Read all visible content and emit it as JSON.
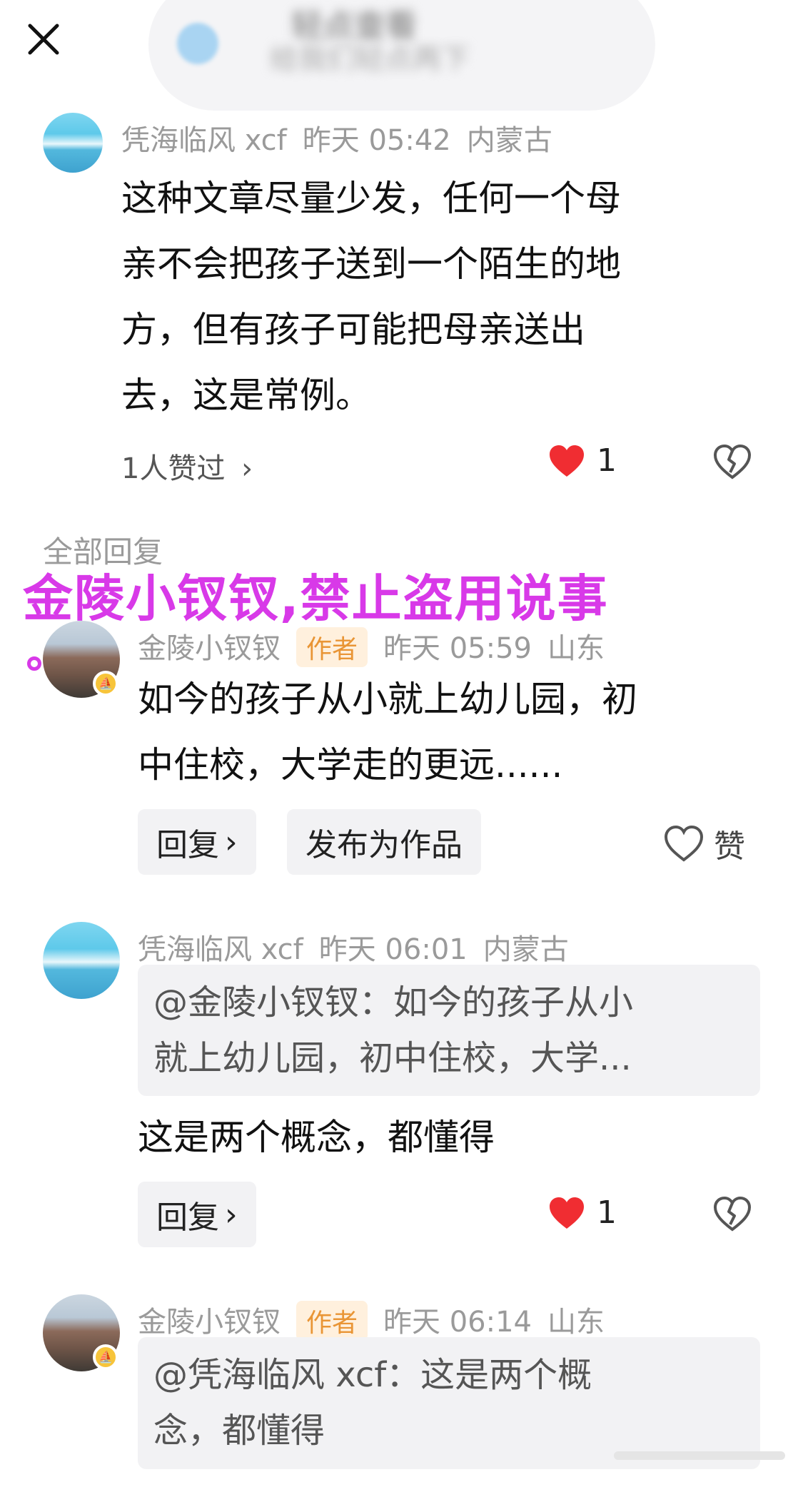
{
  "header": {
    "close_icon": "close-icon",
    "pill_title": "轻点查看",
    "pill_subtitle": "给我们轻点两下"
  },
  "main_comment": {
    "username": "凭海临风 xcf",
    "time": "昨天 05:42",
    "location": "内蒙古",
    "text_lines": [
      "这种文章尽量少发，任何一个母",
      "亲不会把孩子送到一个陌生的地",
      "方，但有孩子可能把母亲送出",
      "去，这是常例。"
    ],
    "likes_summary": "1人赞过",
    "like_count": "1"
  },
  "replies_section": {
    "label": "全部回复",
    "watermark": "金陵小钗钗,禁止盗用说事"
  },
  "replies": [
    {
      "username": "金陵小钗钗",
      "author_tag": "作者",
      "time": "昨天 05:59",
      "location": "山东",
      "text_lines": [
        "如今的孩子从小就上幼儿园，初",
        "中住校，大学走的更远......"
      ],
      "reply_label": "回复",
      "publish_label": "发布为作品",
      "like_label": "赞"
    },
    {
      "username": "凭海临风 xcf",
      "time": "昨天 06:01",
      "location": "内蒙古",
      "quote_lines": [
        "@金陵小钗钗：如今的孩子从小",
        "就上幼儿园，初中住校，大学..."
      ],
      "text": "这是两个概念，都懂得",
      "reply_label": "回复",
      "like_count": "1"
    },
    {
      "username": "金陵小钗钗",
      "author_tag": "作者",
      "time": "昨天 06:14",
      "location": "山东",
      "quote_lines": [
        "@凭海临风 xcf：这是两个概",
        "念，都懂得"
      ]
    }
  ],
  "colors": {
    "heart_red": "#f02d32",
    "watermark": "#d839e8",
    "author_tag_text": "#e99535",
    "author_tag_bg": "#fff0dd"
  }
}
